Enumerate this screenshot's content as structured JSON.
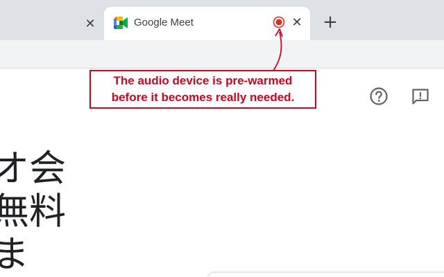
{
  "tabs": [
    {
      "label": "",
      "close_symbol": "✕"
    },
    {
      "label": "Google Meet",
      "close_symbol": "✕",
      "favicon": "google-meet-icon",
      "recording": true
    }
  ],
  "new_tab_symbol": "+",
  "annotation": {
    "line1": "The audio device is pre-warmed",
    "line2": "before it becomes really needed.",
    "color": "#d0021b"
  },
  "header_icons": [
    "help-icon",
    "feedback-icon"
  ],
  "hero": {
    "lines": [
      "デオ会",
      "も無料",
      "けま"
    ]
  },
  "colors": {
    "tabstrip": "#dee1e6",
    "toolbar": "#f1f3f4",
    "recording": "#d93025",
    "icon": "#5f6368"
  }
}
